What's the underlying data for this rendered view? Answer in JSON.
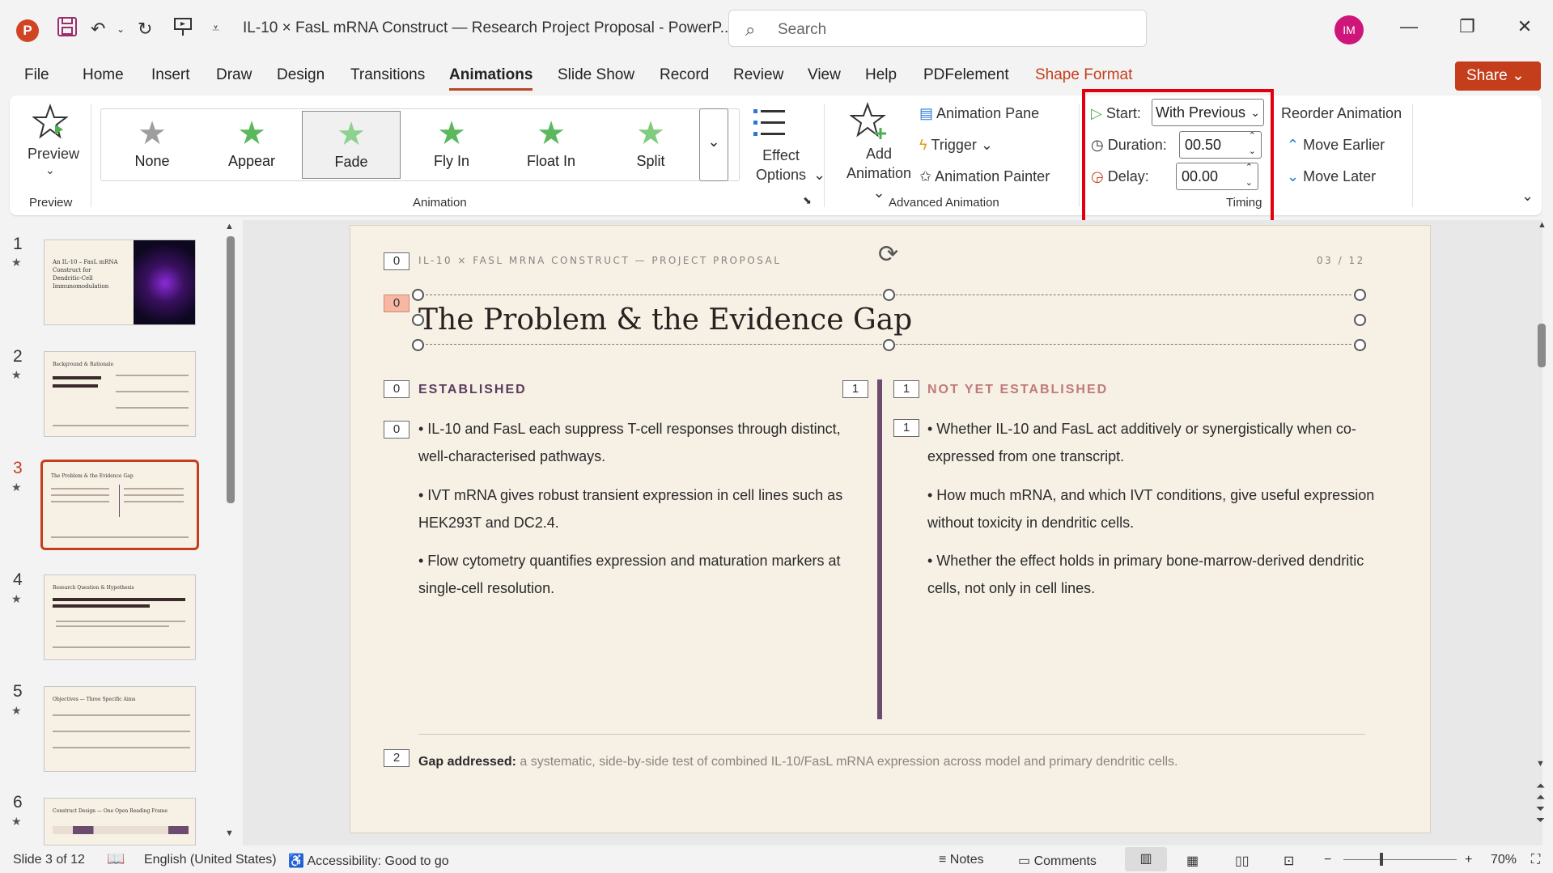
{
  "app": {
    "title": "IL-10 × FasL mRNA Construct — Research Project Proposal  -  PowerP...",
    "logo_letter": "P",
    "search_placeholder": "Search",
    "avatar_initials": "IM",
    "accent_color": "#c43e1c"
  },
  "menu": {
    "tabs": [
      "File",
      "Home",
      "Insert",
      "Draw",
      "Design",
      "Transitions",
      "Animations",
      "Slide Show",
      "Record",
      "Review",
      "View",
      "Help",
      "PDFelement",
      "Shape Format"
    ],
    "active": "Animations",
    "share_label": "Share"
  },
  "ribbon": {
    "preview_label": "Preview",
    "preview_group": "Preview",
    "animation_group": "Animation",
    "gallery": [
      "None",
      "Appear",
      "Fade",
      "Fly In",
      "Float In",
      "Split"
    ],
    "gallery_selected": "Fade",
    "effect_options": "Effect Options",
    "add_animation": "Add Animation",
    "animation_pane": "Animation Pane",
    "trigger": "Trigger",
    "animation_painter": "Animation Painter",
    "advanced_group": "Advanced Animation",
    "start_label": "Start:",
    "start_value": "With Previous",
    "duration_label": "Duration:",
    "duration_value": "00.50",
    "delay_label": "Delay:",
    "delay_value": "00.00",
    "timing_group": "Timing",
    "reorder_label": "Reorder Animation",
    "move_earlier": "Move Earlier",
    "move_later": "Move Later"
  },
  "thumbnails": {
    "numbers": [
      "1",
      "2",
      "3",
      "4",
      "5",
      "6"
    ],
    "current": "3",
    "slide1_title": "An IL-10 – FasL mRNA Construct for Dendritic-Cell Immunomodulation",
    "slide2_title": "Background & Rationale",
    "slide3_title": "The Problem & the Evidence Gap",
    "slide4_title": "Research Question & Hypothesis",
    "slide5_title": "Objectives — Three Specific Aims",
    "slide6_title": "Construct Design — One Open Reading Frame"
  },
  "slide": {
    "header": "IL-10 × FASL MRNA CONSTRUCT — PROJECT PROPOSAL",
    "page": "03 / 12",
    "title": "The Problem & the Evidence Gap",
    "left_head": "ESTABLISHED",
    "right_head": "NOT YET ESTABLISHED",
    "left_bullets": [
      "• IL-10 and FasL each suppress T-cell responses through distinct, well-characterised pathways.",
      "• IVT mRNA gives robust transient expression in cell lines such as HEK293T and DC2.4.",
      "• Flow cytometry quantifies expression and maturation markers at single-cell resolution."
    ],
    "right_bullets": [
      "• Whether IL-10 and FasL act additively or synergistically when co-expressed from one transcript.",
      "• How much mRNA, and which IVT conditions, give useful expression without toxicity in dendritic cells.",
      "• Whether the effect holds in primary bone-marrow-derived dendritic cells, not only in cell lines."
    ],
    "footer_bold": "Gap addressed:",
    "footer_text": " a systematic, side-by-side test of combined IL-10/FasL mRNA expression across model and primary dendritic cells.",
    "tags": {
      "header": "0",
      "title": "0",
      "left_head": "0",
      "left_body": "0",
      "divider": "1",
      "right_head": "1",
      "right_body": "1",
      "footer": "2"
    },
    "head_left_color": "#5b3c5e",
    "head_right_color": "#c07a7a"
  },
  "status": {
    "slide_info": "Slide 3 of 12",
    "language": "English (United States)",
    "accessibility": "Accessibility: Good to go",
    "notes": "Notes",
    "comments": "Comments",
    "zoom": "70%"
  }
}
